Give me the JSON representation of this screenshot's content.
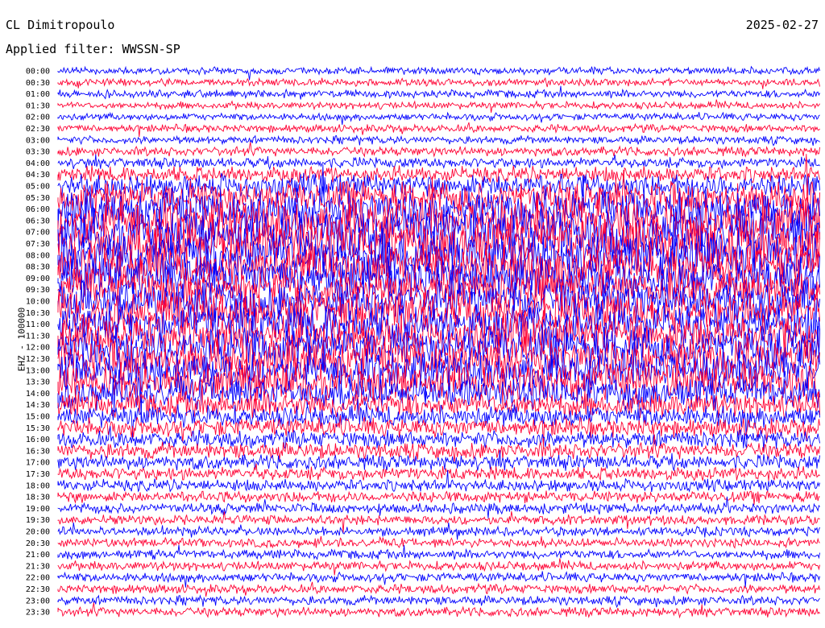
{
  "header": {
    "station": "CL Dimitropoulo",
    "date": "2025-02-27",
    "filter": "Applied filter: WWSSN-SP"
  },
  "chart_data": {
    "type": "line",
    "title": "CL Dimitropoulo",
    "ylabel": "EHZ - 100000",
    "xlabel": "",
    "grid": false,
    "colors": [
      "#0000ff",
      "#ff0033"
    ],
    "row_labels": [
      "00:00",
      "00:30",
      "01:00",
      "01:30",
      "02:00",
      "02:30",
      "03:00",
      "03:30",
      "04:00",
      "04:30",
      "05:00",
      "05:30",
      "06:00",
      "06:30",
      "07:00",
      "07:30",
      "08:00",
      "08:30",
      "09:00",
      "09:30",
      "10:00",
      "10:30",
      "11:00",
      "11:30",
      "12:00",
      "12:30",
      "13:00",
      "13:30",
      "14:00",
      "14:30",
      "15:00",
      "15:30",
      "16:00",
      "16:30",
      "17:00",
      "17:30",
      "18:00",
      "18:30",
      "19:00",
      "19:30",
      "20:00",
      "20:30",
      "21:00",
      "21:30",
      "22:00",
      "22:30",
      "23:00",
      "23:30"
    ],
    "row_amplitude": [
      0.15,
      0.15,
      0.2,
      0.15,
      0.15,
      0.2,
      0.2,
      0.3,
      0.4,
      0.8,
      1.4,
      2.0,
      2.6,
      3.0,
      3.2,
      3.4,
      3.3,
      3.0,
      2.8,
      2.6,
      2.6,
      2.6,
      2.6,
      2.6,
      2.7,
      2.7,
      2.6,
      2.4,
      2.0,
      1.5,
      1.2,
      1.0,
      0.9,
      0.8,
      0.7,
      0.6,
      0.5,
      0.45,
      0.4,
      0.35,
      0.3,
      0.3,
      0.3,
      0.3,
      0.3,
      0.3,
      0.3,
      0.3
    ]
  }
}
